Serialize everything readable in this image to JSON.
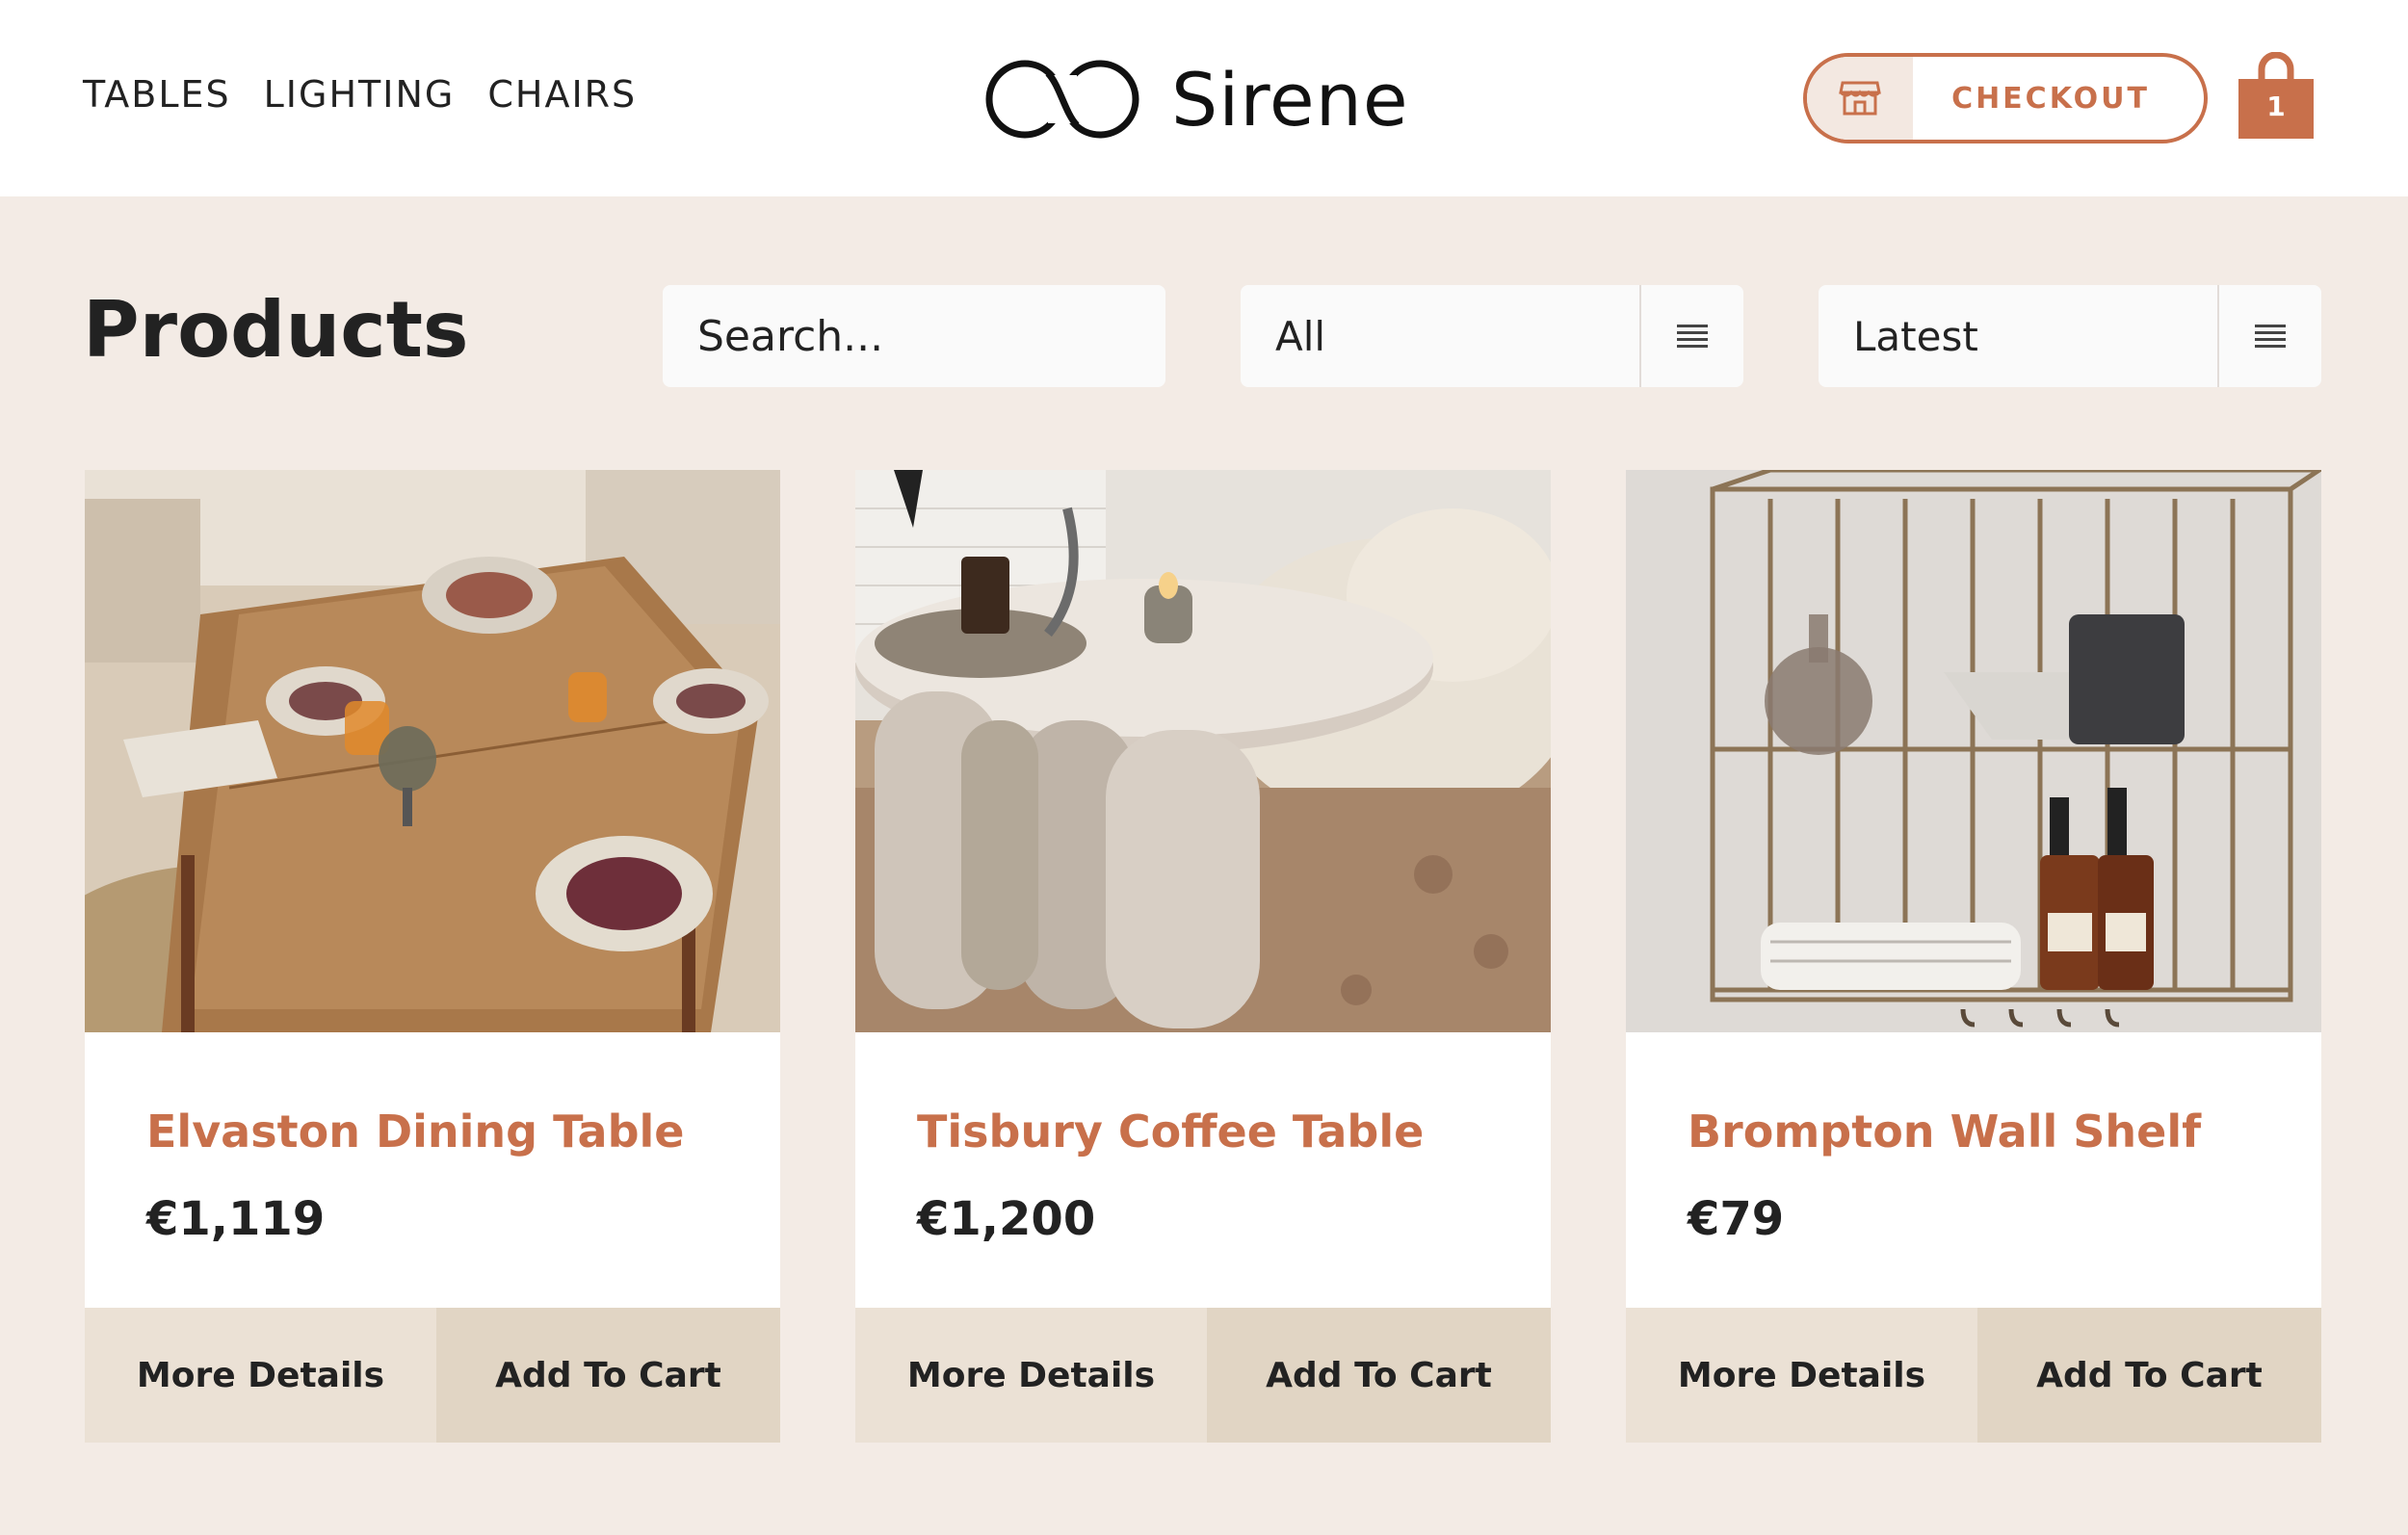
{
  "nav": {
    "items": [
      {
        "label": "TABLES"
      },
      {
        "label": "LIGHTING"
      },
      {
        "label": "CHAIRS"
      }
    ]
  },
  "brand": {
    "name": "Sirene",
    "icon": "infinity-logo-icon"
  },
  "header": {
    "checkout_label": "CHECKOUT",
    "checkout_icon": "store-icon",
    "cart_icon": "shopping-bag-icon",
    "cart_count": "1"
  },
  "colors": {
    "accent": "#c8704b",
    "background": "#f3ebe5",
    "details_button": "#ebe1d5",
    "cart_button": "#e1d5c4"
  },
  "toolbar": {
    "title": "Products",
    "search_placeholder": "Search...",
    "category_value": "All",
    "sort_value": "Latest",
    "handle_icon": "list-lines-icon"
  },
  "products": [
    {
      "name": "Elvaston Dining Table",
      "price": "€1,119",
      "details_label": "More Details",
      "cart_label": "Add To Cart"
    },
    {
      "name": "Tisbury Coffee Table",
      "price": "€1,200",
      "details_label": "More Details",
      "cart_label": "Add To Cart"
    },
    {
      "name": "Brompton Wall Shelf",
      "price": "€79",
      "details_label": "More Details",
      "cart_label": "Add To Cart"
    }
  ]
}
